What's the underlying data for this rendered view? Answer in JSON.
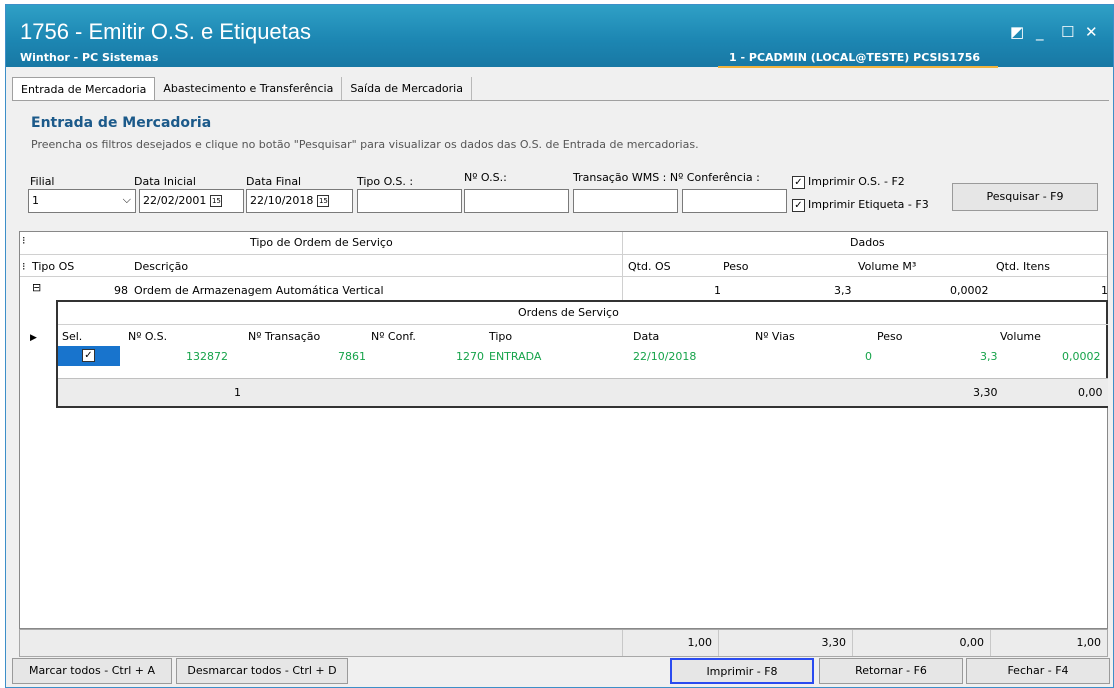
{
  "window": {
    "title": "1756 - Emitir O.S. e Etiquetas",
    "subtitle": "Winthor - PC Sistemas",
    "user": "1 - PCADMIN (LOCAL@TESTE)   PCSIS1756"
  },
  "tabs": [
    "Entrada de Mercadoria",
    "Abastecimento e Transferência",
    "Saída de Mercadoria"
  ],
  "panel": {
    "title": "Entrada de Mercadoria",
    "subtitle": "Preencha os filtros desejados e clique no botão \"Pesquisar\" para visualizar os dados das O.S. de Entrada de mercadorias."
  },
  "filters": {
    "filial_label": "Filial",
    "filial_value": "1",
    "data_inicial_label": "Data Inicial",
    "data_inicial": "22/02/2001",
    "data_final_label": "Data Final",
    "data_final": "22/10/2018",
    "tipo_os_label": "Tipo O.S. :",
    "nro_os_label": "Nº O.S.:",
    "transacao_label": "Transação WMS : Nº Conferência :",
    "cal_icon": "15"
  },
  "checks": {
    "imprimir_os": "Imprimir O.S. - F2",
    "imprimir_etiqueta": "Imprimir Etiqueta - F3"
  },
  "buttons": {
    "pesquisar": "Pesquisar - F9",
    "marcar": "Marcar todos - Ctrl + A",
    "desmarcar": "Desmarcar todos - Ctrl + D",
    "imprimir": "Imprimir - F8",
    "retornar": "Retornar - F6",
    "fechar": "Fechar - F4"
  },
  "grid": {
    "group_tipo": "Tipo de Ordem de Serviço",
    "group_dados": "Dados",
    "cols": {
      "tipo_os": "Tipo OS",
      "descricao": "Descrição",
      "qtd_os": "Qtd. OS",
      "peso": "Peso",
      "volume": "Volume M³",
      "qtd_itens": "Qtd. Itens"
    },
    "row": {
      "tipo_os": "98",
      "descricao": "Ordem de Armazenagem Automática Vertical",
      "qtd_os": "1",
      "peso": "3,3",
      "volume": "0,0002",
      "qtd_itens": "1"
    },
    "detail_title": "Ordens de Serviço",
    "detail_cols": {
      "sel": "Sel.",
      "nro_os": "Nº O.S.",
      "transacao": "Nº Transação",
      "conf": "Nº Conf.",
      "tipo": "Tipo",
      "data": "Data",
      "vias": "Nº Vias",
      "peso": "Peso",
      "volume": "Volume"
    },
    "detail_row": {
      "nro_os": "132872",
      "transacao": "7861",
      "conf": "1270",
      "tipo": "ENTRADA",
      "data": "22/10/2018",
      "vias": "0",
      "peso": "3,3",
      "volume": "0,0002"
    },
    "detail_footer": {
      "count": "1",
      "peso": "3,30",
      "volume": "0,00"
    }
  },
  "summary": {
    "qtd_os": "1,00",
    "peso": "3,30",
    "volume": "0,00",
    "qtd_itens": "1,00"
  }
}
